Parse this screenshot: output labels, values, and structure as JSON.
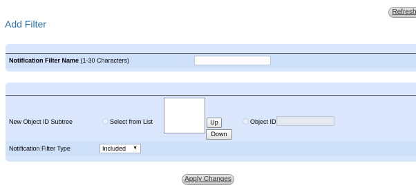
{
  "header": {
    "refresh_label": "Refresh",
    "title": "Add Filter"
  },
  "filter_name": {
    "label_bold": "Notification Filter Name",
    "label_hint": " (1-30 Characters)",
    "value": ""
  },
  "subtree": {
    "label": "New Object ID Subtree",
    "select_from_list_label": "Select from List",
    "up_label": "Up",
    "down_label": "Down",
    "object_id_label": "Object ID",
    "object_id_value": ""
  },
  "filter_type": {
    "label": "Notification Filter Type",
    "selected": "Included"
  },
  "footer": {
    "apply_label": "Apply Changes"
  }
}
